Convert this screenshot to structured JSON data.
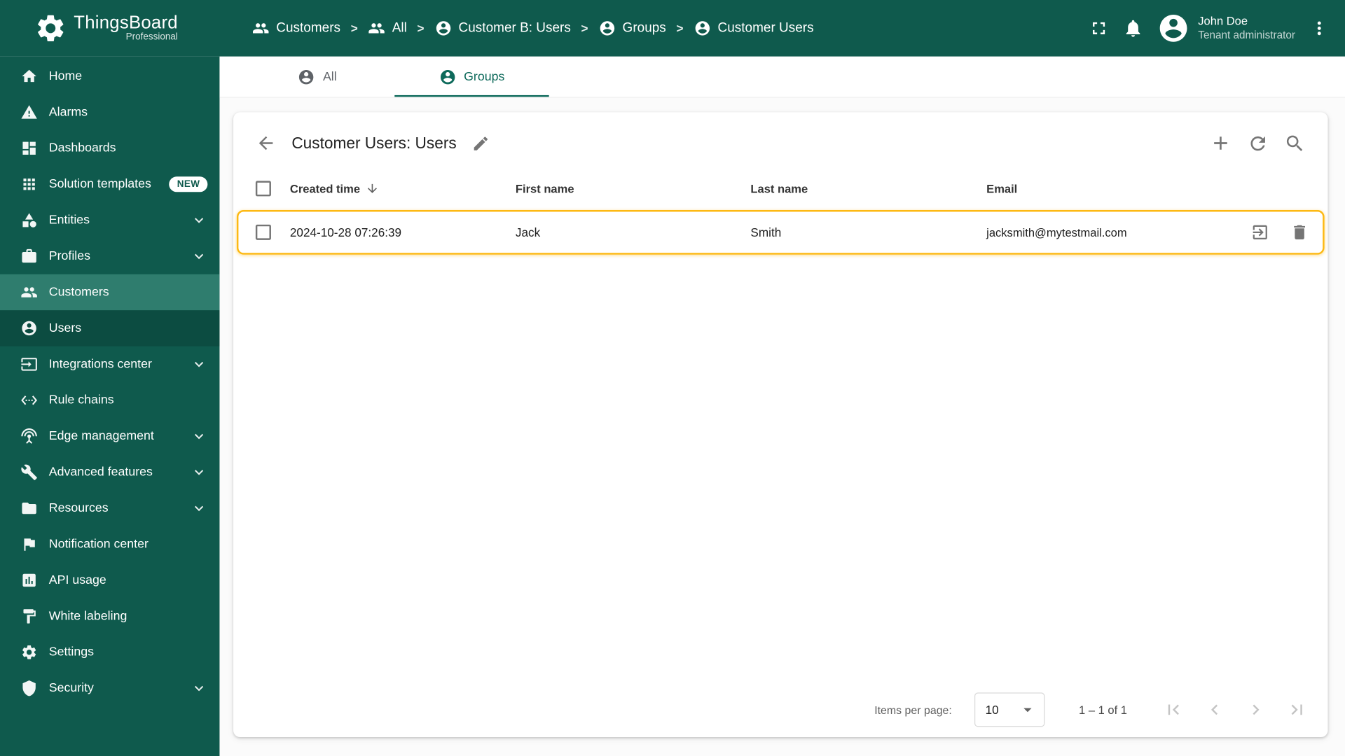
{
  "brand": {
    "name": "ThingsBoard",
    "subtitle": "Professional"
  },
  "header": {
    "breadcrumb": [
      {
        "label": "Customers"
      },
      {
        "label": "All"
      },
      {
        "label": "Customer B: Users"
      },
      {
        "label": "Groups"
      },
      {
        "label": "Customer Users"
      }
    ],
    "user": {
      "name": "John Doe",
      "role": "Tenant administrator"
    }
  },
  "sidebar": {
    "items": [
      {
        "label": "Home"
      },
      {
        "label": "Alarms"
      },
      {
        "label": "Dashboards"
      },
      {
        "label": "Solution templates",
        "badge": "NEW"
      },
      {
        "label": "Entities",
        "expandable": true
      },
      {
        "label": "Profiles",
        "expandable": true
      },
      {
        "label": "Customers",
        "active": true
      },
      {
        "label": "Users"
      },
      {
        "label": "Integrations center",
        "expandable": true
      },
      {
        "label": "Rule chains"
      },
      {
        "label": "Edge management",
        "expandable": true
      },
      {
        "label": "Advanced features",
        "expandable": true
      },
      {
        "label": "Resources",
        "expandable": true
      },
      {
        "label": "Notification center"
      },
      {
        "label": "API usage"
      },
      {
        "label": "White labeling"
      },
      {
        "label": "Settings"
      },
      {
        "label": "Security",
        "expandable": true
      }
    ]
  },
  "tabs": {
    "all": "All",
    "groups": "Groups"
  },
  "card": {
    "title": "Customer Users: Users",
    "table": {
      "columns": {
        "created": "Created time",
        "first": "First name",
        "last": "Last name",
        "email": "Email"
      },
      "rows": [
        {
          "created": "2024-10-28 07:26:39",
          "first": "Jack",
          "last": "Smith",
          "email": "jacksmith@mytestmail.com"
        }
      ]
    },
    "paginator": {
      "items_per_page_label": "Items per page:",
      "page_size": "10",
      "range": "1 – 1 of 1"
    }
  },
  "colors": {
    "primary": "#0f5a4d",
    "primary_active": "#2f7d6e",
    "accent": "#0e6a5b",
    "row_highlight_border": "#fdb913"
  }
}
